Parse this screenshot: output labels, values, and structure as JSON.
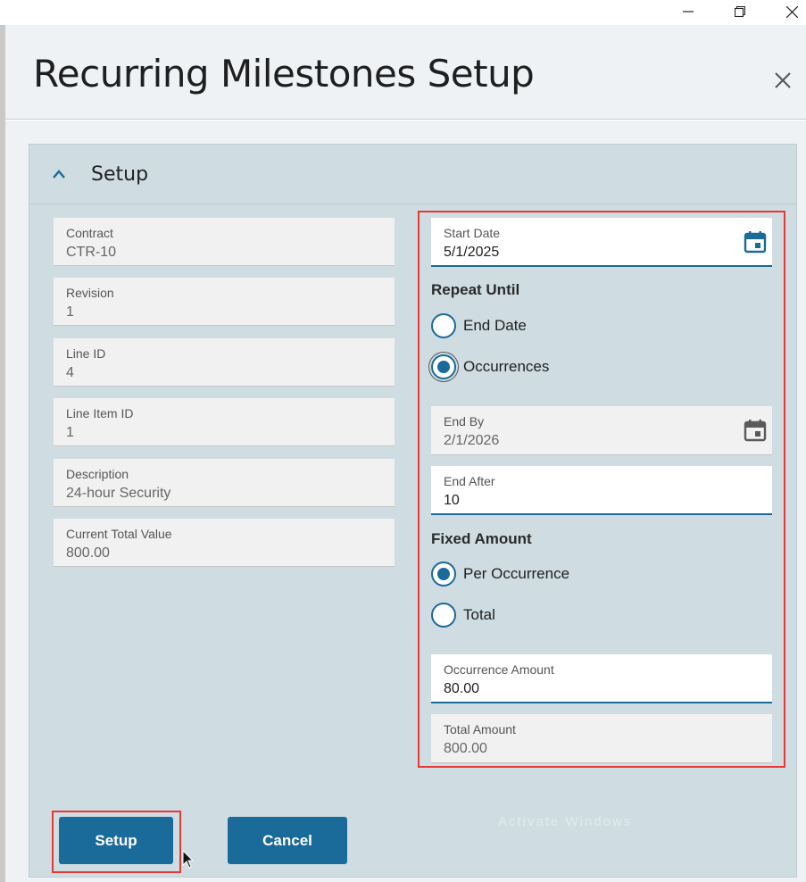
{
  "window": {
    "controls": [
      "minimize-icon",
      "restore-icon",
      "close-icon"
    ]
  },
  "dialog": {
    "title": "Recurring Milestones Setup"
  },
  "panel": {
    "title": "Setup"
  },
  "left_fields": [
    {
      "label": "Contract",
      "value": "CTR-10"
    },
    {
      "label": "Revision",
      "value": "1"
    },
    {
      "label": "Line ID",
      "value": "4"
    },
    {
      "label": "Line Item ID",
      "value": "1"
    },
    {
      "label": "Description",
      "value": "24-hour Security"
    },
    {
      "label": "Current Total Value",
      "value": "800.00"
    }
  ],
  "right": {
    "start_date": {
      "label": "Start Date",
      "value": "5/1/2025"
    },
    "repeat_until": {
      "label": "Repeat Until",
      "options": [
        {
          "label": "End Date",
          "checked": false
        },
        {
          "label": "Occurrences",
          "checked": true
        }
      ]
    },
    "end_by": {
      "label": "End By",
      "value": "2/1/2026"
    },
    "end_after": {
      "label": "End After",
      "value": "10"
    },
    "fixed_amount": {
      "label": "Fixed Amount",
      "options": [
        {
          "label": "Per Occurrence",
          "checked": true
        },
        {
          "label": "Total",
          "checked": false
        }
      ]
    },
    "occurrence_amount": {
      "label": "Occurrence Amount",
      "value": "80.00"
    },
    "total_amount": {
      "label": "Total Amount",
      "value": "800.00"
    }
  },
  "buttons": {
    "setup": "Setup",
    "cancel": "Cancel"
  },
  "watermark": "Activate Windows",
  "colors": {
    "accent": "#1a6a9a",
    "highlight": "#e53935",
    "panel_bg": "#cfdde2"
  }
}
